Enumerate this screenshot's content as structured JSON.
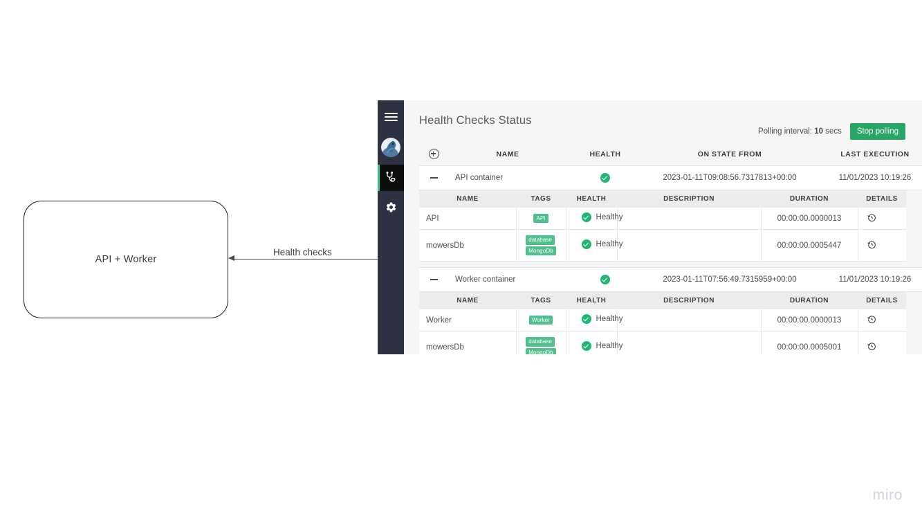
{
  "diagram": {
    "box_label": "API + Worker",
    "connector_label": "Health checks",
    "watermark": "miro"
  },
  "app": {
    "sidebar": {
      "items": [
        {
          "name": "menu-toggle",
          "icon": "hamburger-icon",
          "active": false
        },
        {
          "name": "user-avatar",
          "icon": "avatar-icon",
          "active": false
        },
        {
          "name": "health-checks",
          "icon": "stethoscope-heart-icon",
          "active": true
        },
        {
          "name": "settings",
          "icon": "gear-icon",
          "active": false
        }
      ],
      "accent_color": "#2ecc8f",
      "bg_color": "#2d3142"
    },
    "header": {
      "title": "Health Checks Status",
      "polling_prefix": "Polling interval:",
      "polling_value": "10",
      "polling_suffix": "secs",
      "stop_polling_label": "Stop polling",
      "stop_polling_color": "#28a668"
    },
    "outer_columns": [
      "",
      "NAME",
      "HEALTH",
      "ON STATE FROM",
      "LAST EXECUTION"
    ],
    "inner_columns": [
      "NAME",
      "TAGS",
      "HEALTH",
      "DESCRIPTION",
      "DURATION",
      "DETAILS"
    ],
    "containers": [
      {
        "name": "API container",
        "health_status": "healthy",
        "on_state_from": "2023-01-11T09:08:56.7317813+00:00",
        "last_execution": "11/01/2023 10:19:26",
        "expanded": true,
        "checks": [
          {
            "name": "API",
            "tags": [
              "API"
            ],
            "health": "Healthy",
            "description": "",
            "duration": "00:00:00.0000013",
            "details_icon": "history-clock-icon"
          },
          {
            "name": "mowersDb",
            "tags": [
              "database",
              "MongoDb"
            ],
            "health": "Healthy",
            "description": "",
            "duration": "00:00:00.0005447",
            "details_icon": "history-clock-icon"
          }
        ]
      },
      {
        "name": "Worker container",
        "health_status": "healthy",
        "on_state_from": "2023-01-11T07:56:49.7315959+00:00",
        "last_execution": "11/01/2023 10:19:26",
        "expanded": true,
        "checks": [
          {
            "name": "Worker",
            "tags": [
              "Worker"
            ],
            "health": "Healthy",
            "description": "",
            "duration": "00:00:00.0000013",
            "details_icon": "history-clock-icon"
          },
          {
            "name": "mowersDb",
            "tags": [
              "database",
              "MongoDb"
            ],
            "health": "Healthy",
            "description": "",
            "duration": "00:00:00.0005001",
            "details_icon": "history-clock-icon"
          }
        ]
      }
    ],
    "colors": {
      "tag_green": "#4fbf8b",
      "health_green": "#22b573",
      "button_green": "#28a668"
    }
  }
}
